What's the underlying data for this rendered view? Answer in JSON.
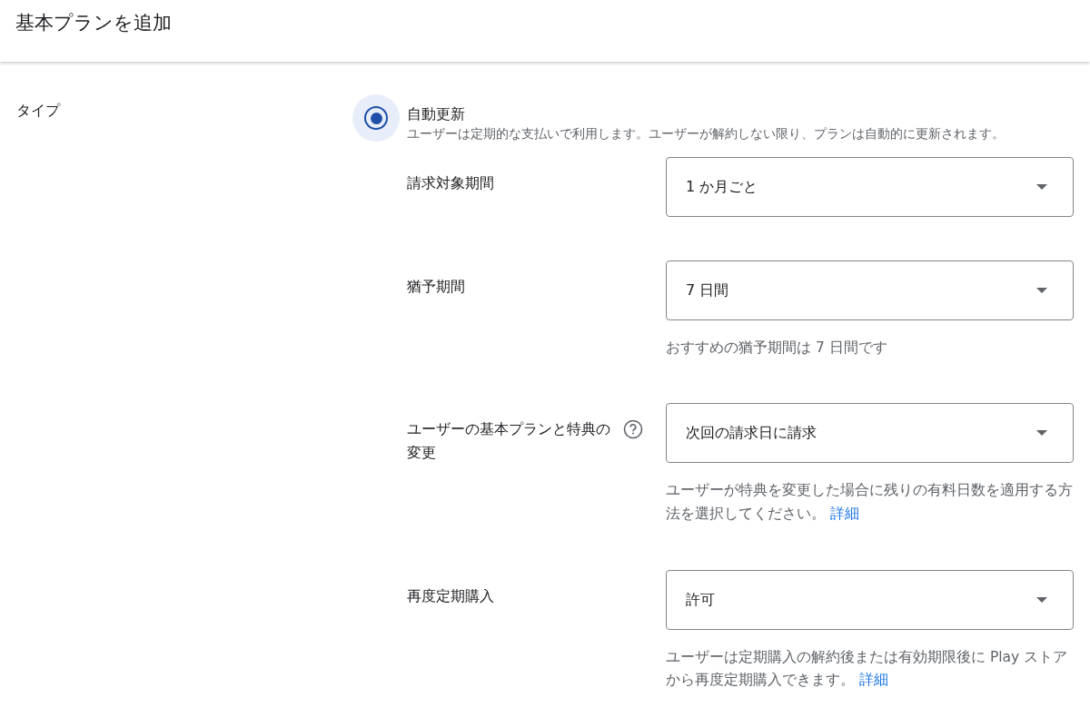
{
  "page": {
    "title": "基本プランを追加"
  },
  "type_section": {
    "label": "タイプ",
    "option": {
      "title": "自動更新",
      "description": "ユーザーは定期的な支払いで利用します。ユーザーが解約しない限り、プランは自動的に更新されます。",
      "selected": true
    }
  },
  "fields": [
    {
      "label": "請求対象期間",
      "help": false,
      "value": "1 か月ごと"
    },
    {
      "label": "猶予期間",
      "help": false,
      "value": "7 日間",
      "hint": {
        "text": "おすすめの猶予期間は 7 日間です"
      }
    },
    {
      "label": "ユーザーの基本プランと特典の変更",
      "help": true,
      "value": "次回の請求日に請求",
      "hint": {
        "text": "ユーザーが特典を変更した場合に残りの有料日数を適用する方法を選択してください。",
        "link": "詳細"
      }
    },
    {
      "label": "再度定期購入",
      "help": false,
      "value": "許可",
      "hint": {
        "text": "ユーザーは定期購入の解約後または有効期限後に Play ストアから再度定期購入できます。",
        "link": "詳細"
      }
    }
  ]
}
